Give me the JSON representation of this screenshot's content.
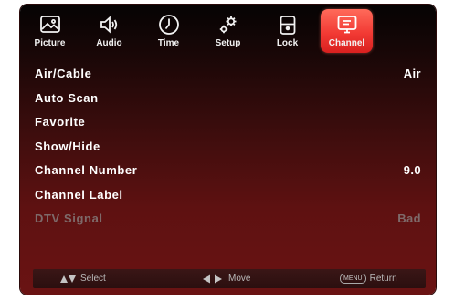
{
  "tabs": [
    {
      "label": "Picture",
      "icon": "picture-icon",
      "active": false
    },
    {
      "label": "Audio",
      "icon": "audio-icon",
      "active": false
    },
    {
      "label": "Time",
      "icon": "clock-icon",
      "active": false
    },
    {
      "label": "Setup",
      "icon": "gears-icon",
      "active": false
    },
    {
      "label": "Lock",
      "icon": "lock-icon",
      "active": false
    },
    {
      "label": "Channel",
      "icon": "tv-icon",
      "active": true
    }
  ],
  "menu": {
    "items": [
      {
        "label": "Air/Cable",
        "value": "Air",
        "enabled": true
      },
      {
        "label": "Auto Scan",
        "value": "",
        "enabled": true
      },
      {
        "label": "Favorite",
        "value": "",
        "enabled": true
      },
      {
        "label": "Show/Hide",
        "value": "",
        "enabled": true
      },
      {
        "label": "Channel Number",
        "value": "9.0",
        "enabled": true
      },
      {
        "label": "Channel Label",
        "value": "",
        "enabled": true
      },
      {
        "label": "DTV Signal",
        "value": "Bad",
        "enabled": false
      }
    ]
  },
  "footer": {
    "select_label": "Select",
    "move_label": "Move",
    "menu_key": "MENU",
    "return_label": "Return"
  },
  "colors": {
    "active_tab": "#f23a34",
    "disabled_text": "#7e6a6a",
    "background_bottom": "#6a1313"
  }
}
